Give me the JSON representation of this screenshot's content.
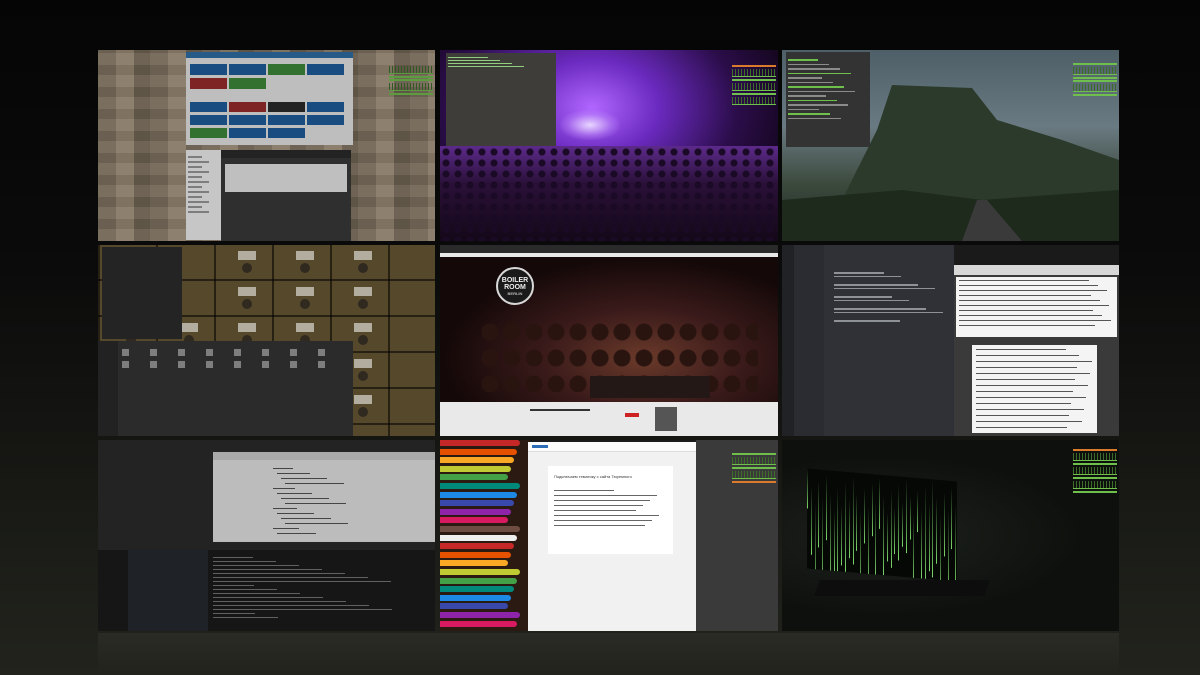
{
  "workspaces": [
    {
      "id": 1,
      "theme": "kanban-board-over-paper-wall"
    },
    {
      "id": 2,
      "theme": "concert-crowd-with-terminal"
    },
    {
      "id": 3,
      "theme": "mountain-road-with-file-manager"
    },
    {
      "id": 4,
      "theme": "drawer-wall-with-file-browser"
    },
    {
      "id": 5,
      "theme": "video-player-dj-set"
    },
    {
      "id": 6,
      "theme": "chat-and-document-editor"
    },
    {
      "id": 7,
      "theme": "code-editor-and-terminal"
    },
    {
      "id": 8,
      "theme": "colored-pencils-with-blog-editor"
    },
    {
      "id": 9,
      "theme": "laptop-with-matrix-code"
    }
  ],
  "video": {
    "logo_line1": "BOILER",
    "logo_line2": "ROOM",
    "logo_line3": "BERLIN"
  },
  "blog": {
    "title": "Подключаем тематику с сайта Тюремного"
  },
  "colors": {
    "conky_green": "#6fbf4c",
    "conky_orange": "#d97b2a",
    "kanban_blue": "#1f5f9e",
    "kanban_green": "#3e8a3b",
    "kanban_red": "#9a2d2d"
  }
}
